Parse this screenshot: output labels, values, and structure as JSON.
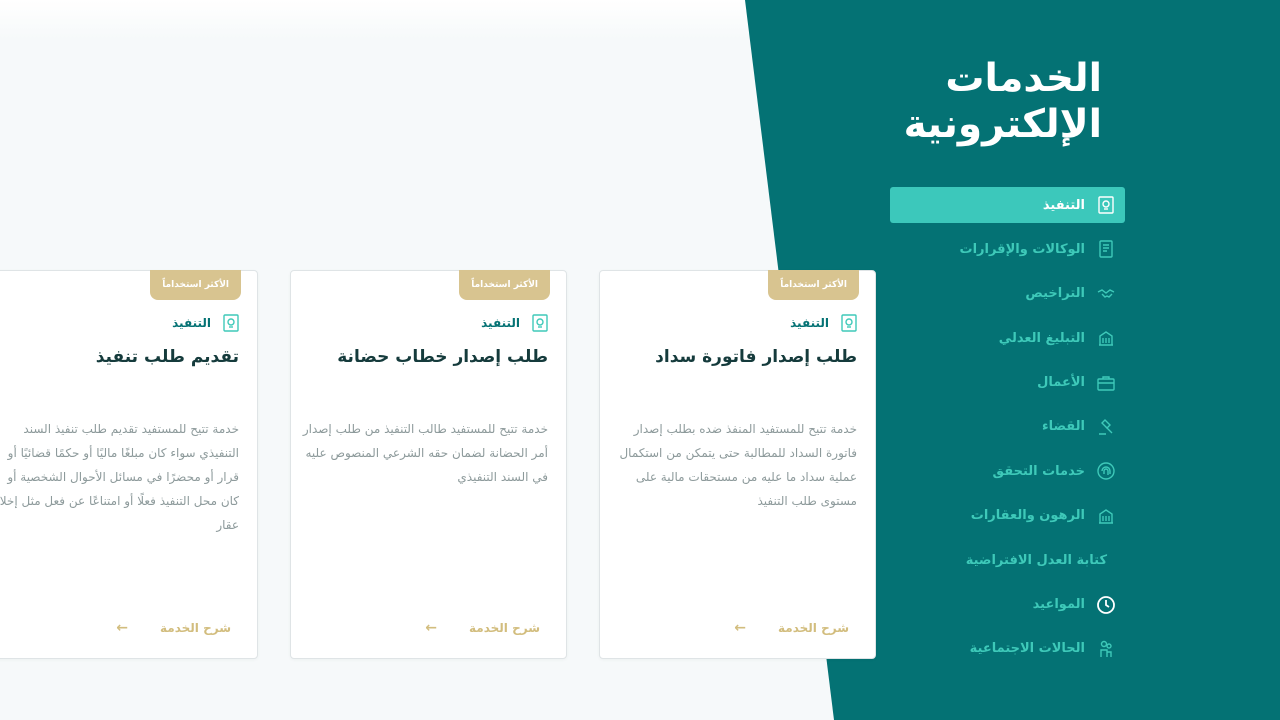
{
  "page_title": "الخدمات الإلكترونية",
  "nav": [
    {
      "label": "التنفيذ",
      "icon": "document-seal-icon",
      "active": true
    },
    {
      "label": "الوكالات والإقرارات",
      "icon": "document-list-icon"
    },
    {
      "label": "التراخيص",
      "icon": "handshake-icon"
    },
    {
      "label": "التبليغ العدلي",
      "icon": "building-icon"
    },
    {
      "label": "الأعمال",
      "icon": "briefcase-icon"
    },
    {
      "label": "القضاء",
      "icon": "gavel-icon"
    },
    {
      "label": "خدمات التحقق",
      "icon": "fingerprint-icon"
    },
    {
      "label": "الرهون والعقارات",
      "icon": "building-icon"
    },
    {
      "label": "كتابة العدل الافتراضية",
      "icon": ""
    },
    {
      "label": "المواعيد",
      "icon": "clock-icon"
    },
    {
      "label": "الحالات الاجتماعية",
      "icon": "people-icon"
    }
  ],
  "cards": [
    {
      "badge": "الأكثر استخداماً",
      "category": "التنفيذ",
      "title": "طلب إصدار فاتورة سداد",
      "description": "خدمة تتيح للمستفيد المنفذ ضده بطلب إصدار فاتورة السداد للمطالبة حتى يتمكن من استكمال عملية سداد ما عليه من مستحقات مالية على مستوى طلب التنفيذ",
      "link": "شرح الخدمة"
    },
    {
      "badge": "الأكثر استخداماً",
      "category": "التنفيذ",
      "title": "طلب إصدار خطاب حضانة",
      "description": "خدمة تتيح للمستفيد طالب التنفيذ من طلب إصدار أمر الحضانة لضمان حقه الشرعي المنصوص عليه في السند التنفيذي",
      "link": "شرح الخدمة"
    },
    {
      "badge": "الأكثر استخداماً",
      "category": "التنفيذ",
      "title": "تقديم طلب تنفيذ",
      "description": "خدمة تتيح للمستفيد تقديم طلب تنفيذ السند التنفيذي سواء كان مبلغًا ماليًا أو حكمًا قضائيًا أو قرار أو محضرًا في مسائل الأحوال الشخصية أو كان محل التنفيذ فعلًا أو امتناعًا عن فعل مثل إخلاء عقار",
      "link": "شرح الخدمة"
    }
  ],
  "colors": {
    "teal": "#047274",
    "active": "#3cc8bb",
    "gold": "#d8c490"
  }
}
